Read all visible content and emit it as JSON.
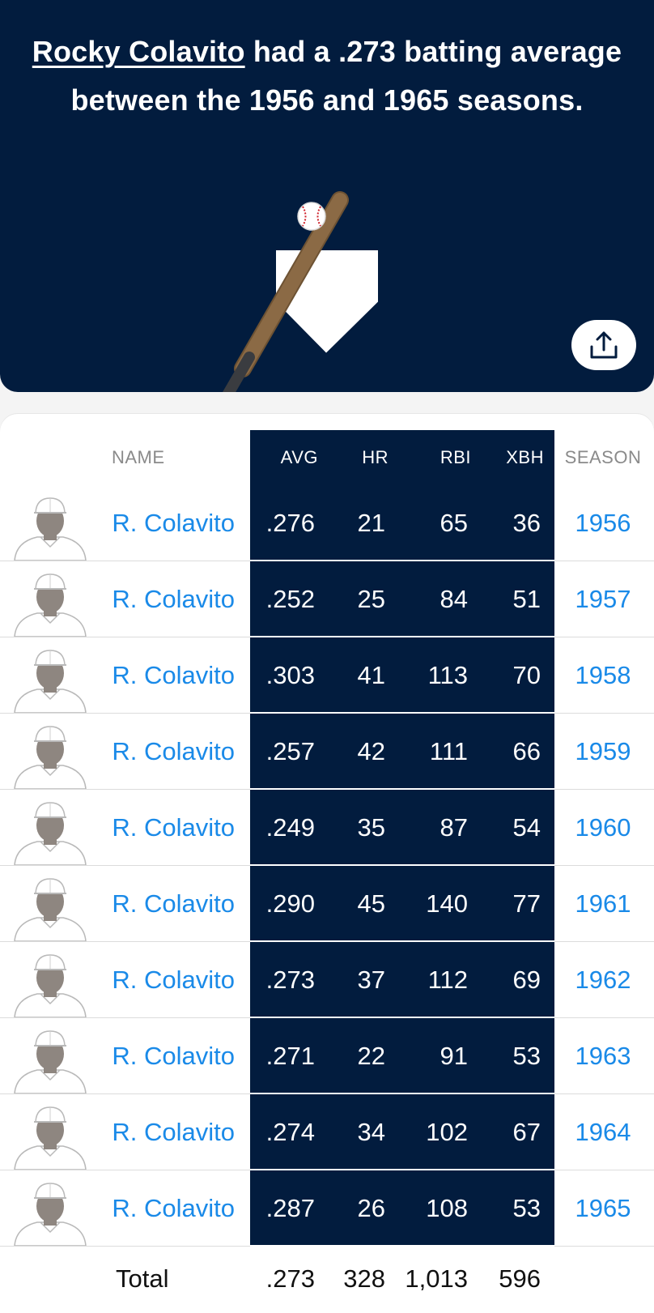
{
  "headline": {
    "player_link": "Rocky Colavito",
    "rest": " had a .273 batting average between the 1956 and 1965 seasons."
  },
  "share": {
    "icon": "share-upload-icon"
  },
  "table": {
    "headers": {
      "name": "NAME",
      "avg": "AVG",
      "hr": "HR",
      "rbi": "RBI",
      "xbh": "XBH",
      "season": "SEASON"
    },
    "rows": [
      {
        "name": "R. Colavito",
        "avg": ".276",
        "hr": "21",
        "rbi": "65",
        "xbh": "36",
        "season": "1956"
      },
      {
        "name": "R. Colavito",
        "avg": ".252",
        "hr": "25",
        "rbi": "84",
        "xbh": "51",
        "season": "1957"
      },
      {
        "name": "R. Colavito",
        "avg": ".303",
        "hr": "41",
        "rbi": "113",
        "xbh": "70",
        "season": "1958"
      },
      {
        "name": "R. Colavito",
        "avg": ".257",
        "hr": "42",
        "rbi": "111",
        "xbh": "66",
        "season": "1959"
      },
      {
        "name": "R. Colavito",
        "avg": ".249",
        "hr": "35",
        "rbi": "87",
        "xbh": "54",
        "season": "1960"
      },
      {
        "name": "R. Colavito",
        "avg": ".290",
        "hr": "45",
        "rbi": "140",
        "xbh": "77",
        "season": "1961"
      },
      {
        "name": "R. Colavito",
        "avg": ".273",
        "hr": "37",
        "rbi": "112",
        "xbh": "69",
        "season": "1962"
      },
      {
        "name": "R. Colavito",
        "avg": ".271",
        "hr": "22",
        "rbi": "91",
        "xbh": "53",
        "season": "1963"
      },
      {
        "name": "R. Colavito",
        "avg": ".274",
        "hr": "34",
        "rbi": "102",
        "xbh": "67",
        "season": "1964"
      },
      {
        "name": "R. Colavito",
        "avg": ".287",
        "hr": "26",
        "rbi": "108",
        "xbh": "53",
        "season": "1965"
      }
    ],
    "total": {
      "label": "Total",
      "avg": ".273",
      "hr": "328",
      "rbi": "1,013",
      "xbh": "596"
    }
  },
  "colors": {
    "navy": "#021c3e",
    "link_blue": "#1a8ae8",
    "bat_brown": "#8b6a45",
    "bat_handle": "#3a3c40"
  }
}
